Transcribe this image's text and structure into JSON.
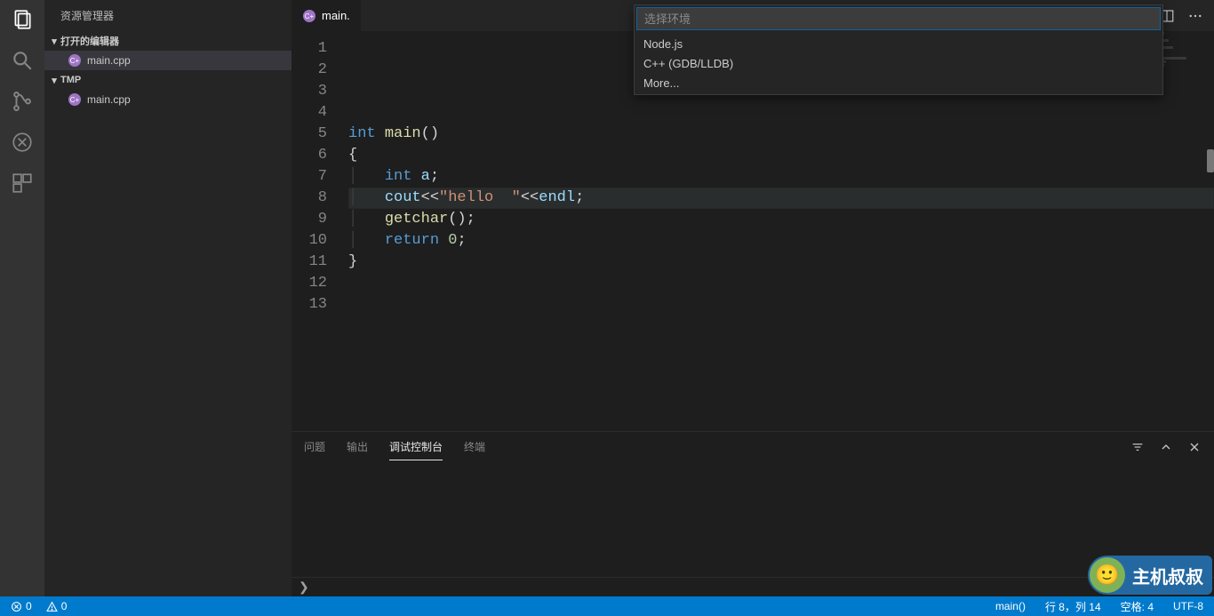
{
  "sidebar": {
    "title": "资源管理器",
    "sections": {
      "openEditors": {
        "label": "打开的编辑器",
        "items": [
          {
            "name": "main.cpp"
          }
        ]
      },
      "folder": {
        "label": "TMP",
        "items": [
          {
            "name": "main.cpp"
          }
        ]
      }
    }
  },
  "tabs": {
    "active": {
      "name": "main."
    }
  },
  "quickInput": {
    "placeholder": "选择环境",
    "options": [
      "Node.js",
      "C++ (GDB/LLDB)",
      "More..."
    ]
  },
  "editor": {
    "lineCount": 13,
    "lines": [
      {
        "n": 1,
        "tokens": []
      },
      {
        "n": 2,
        "tokens": []
      },
      {
        "n": 3,
        "tokens": []
      },
      {
        "n": 4,
        "tokens": []
      },
      {
        "n": 5,
        "tokens": [
          {
            "t": "int ",
            "c": "kw"
          },
          {
            "t": "main",
            "c": "fn"
          },
          {
            "t": "()",
            "c": "pln"
          }
        ]
      },
      {
        "n": 6,
        "tokens": [
          {
            "t": "{",
            "c": "pln"
          }
        ]
      },
      {
        "n": 7,
        "tokens": [
          {
            "t": "│   ",
            "c": "indent-guide"
          },
          {
            "t": "int ",
            "c": "kw"
          },
          {
            "t": "a",
            "c": "id"
          },
          {
            "t": ";",
            "c": "pln"
          }
        ]
      },
      {
        "n": 8,
        "hl": true,
        "tokens": [
          {
            "t": "│   ",
            "c": "indent-guide"
          },
          {
            "t": "cout",
            "c": "id"
          },
          {
            "t": "<<",
            "c": "pln"
          },
          {
            "t": "\"hello  \"",
            "c": "str"
          },
          {
            "t": "<<",
            "c": "pln"
          },
          {
            "t": "endl",
            "c": "id"
          },
          {
            "t": ";",
            "c": "pln"
          }
        ]
      },
      {
        "n": 9,
        "tokens": [
          {
            "t": "│   ",
            "c": "indent-guide"
          },
          {
            "t": "getchar",
            "c": "fn"
          },
          {
            "t": "();",
            "c": "pln"
          }
        ]
      },
      {
        "n": 10,
        "tokens": [
          {
            "t": "│   ",
            "c": "indent-guide"
          },
          {
            "t": "return ",
            "c": "kw"
          },
          {
            "t": "0",
            "c": "num"
          },
          {
            "t": ";",
            "c": "pln"
          }
        ]
      },
      {
        "n": 11,
        "tokens": [
          {
            "t": "}",
            "c": "pln"
          }
        ]
      },
      {
        "n": 12,
        "tokens": []
      },
      {
        "n": 13,
        "tokens": []
      }
    ]
  },
  "panel": {
    "tabs": {
      "problems": "问题",
      "output": "输出",
      "debugConsole": "调试控制台",
      "terminal": "终端"
    },
    "active": "debugConsole"
  },
  "breadcrumb": "❯",
  "status": {
    "errors": "0",
    "warnings": "0",
    "scope": "main()",
    "lineCol": "行 8，列 14",
    "spaces": "空格: 4",
    "encoding": "UTF-8"
  },
  "watermark": "主机叔叔"
}
